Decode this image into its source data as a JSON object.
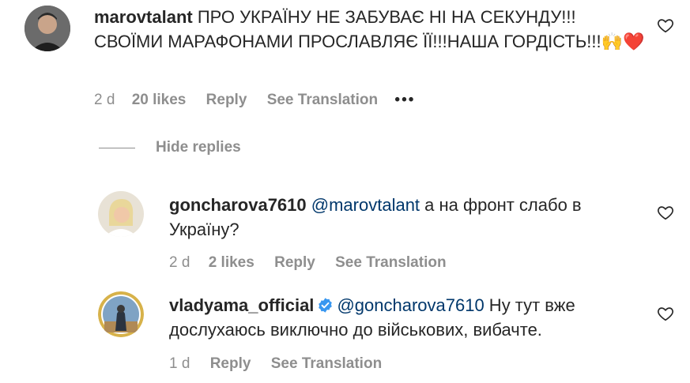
{
  "comments": [
    {
      "username": "marovtalant",
      "text": "ПРО УКРАЇНУ НЕ ЗАБУВАЄ НІ НА СЕКУНДУ!!! СВОЇМИ МАРАФОНАМИ ПРОСЛАВЛЯЄ ЇЇ!!!НАША ГОРДІСТЬ!!!🙌❤️",
      "time": "2 d",
      "likes": "20 likes",
      "reply": "Reply",
      "translate": "See Translation",
      "more": "•••"
    },
    {
      "username": "goncharova7610",
      "mention": "@marovtalant",
      "text": " а на фронт слабо в Україну?",
      "time": "2 d",
      "likes": "2 likes",
      "reply": "Reply",
      "translate": "See Translation"
    },
    {
      "username": "vladyama_official",
      "verified": true,
      "mention": "@goncharova7610",
      "text": " Ну тут вже дослухаюсь виключно до військових, вибачте.",
      "time": "1 d",
      "reply": "Reply",
      "translate": "See Translation"
    }
  ],
  "hide_replies": "Hide replies",
  "icons": {
    "like": "heart-icon",
    "verified": "verified-badge-icon",
    "more": "more-options-icon"
  },
  "colors": {
    "mention": "#00376b",
    "meta": "#8e8e8e",
    "verified": "#3897f0",
    "heart": "#262626"
  }
}
